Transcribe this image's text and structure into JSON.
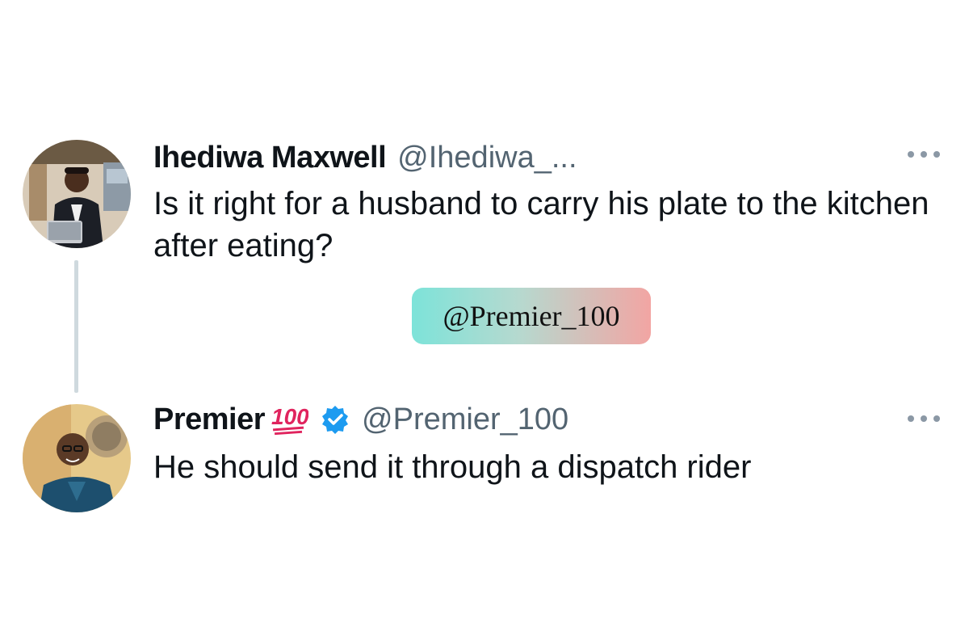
{
  "tweets": [
    {
      "display_name": "Ihediwa Maxwell",
      "handle": "@Ihediwa_...",
      "text": "Is it right for a husband to carry his plate to the kitchen after eating?",
      "avatar": "person-avatar"
    },
    {
      "display_name": "Premier",
      "name_emoji": "hundred-points-emoji",
      "verified": true,
      "handle": "@Premier_100",
      "text": "He should send it through a dispatch rider",
      "avatar": "person-avatar"
    }
  ],
  "watermark": {
    "text": "@Premier_100"
  },
  "colors": {
    "text_primary": "#0f1419",
    "text_secondary": "#536471",
    "verified_blue": "#1d9bf0",
    "thread_line": "#cfd9de",
    "watermark_gradient_start": "#7de3d9",
    "watermark_gradient_end": "#f2a5a3"
  }
}
